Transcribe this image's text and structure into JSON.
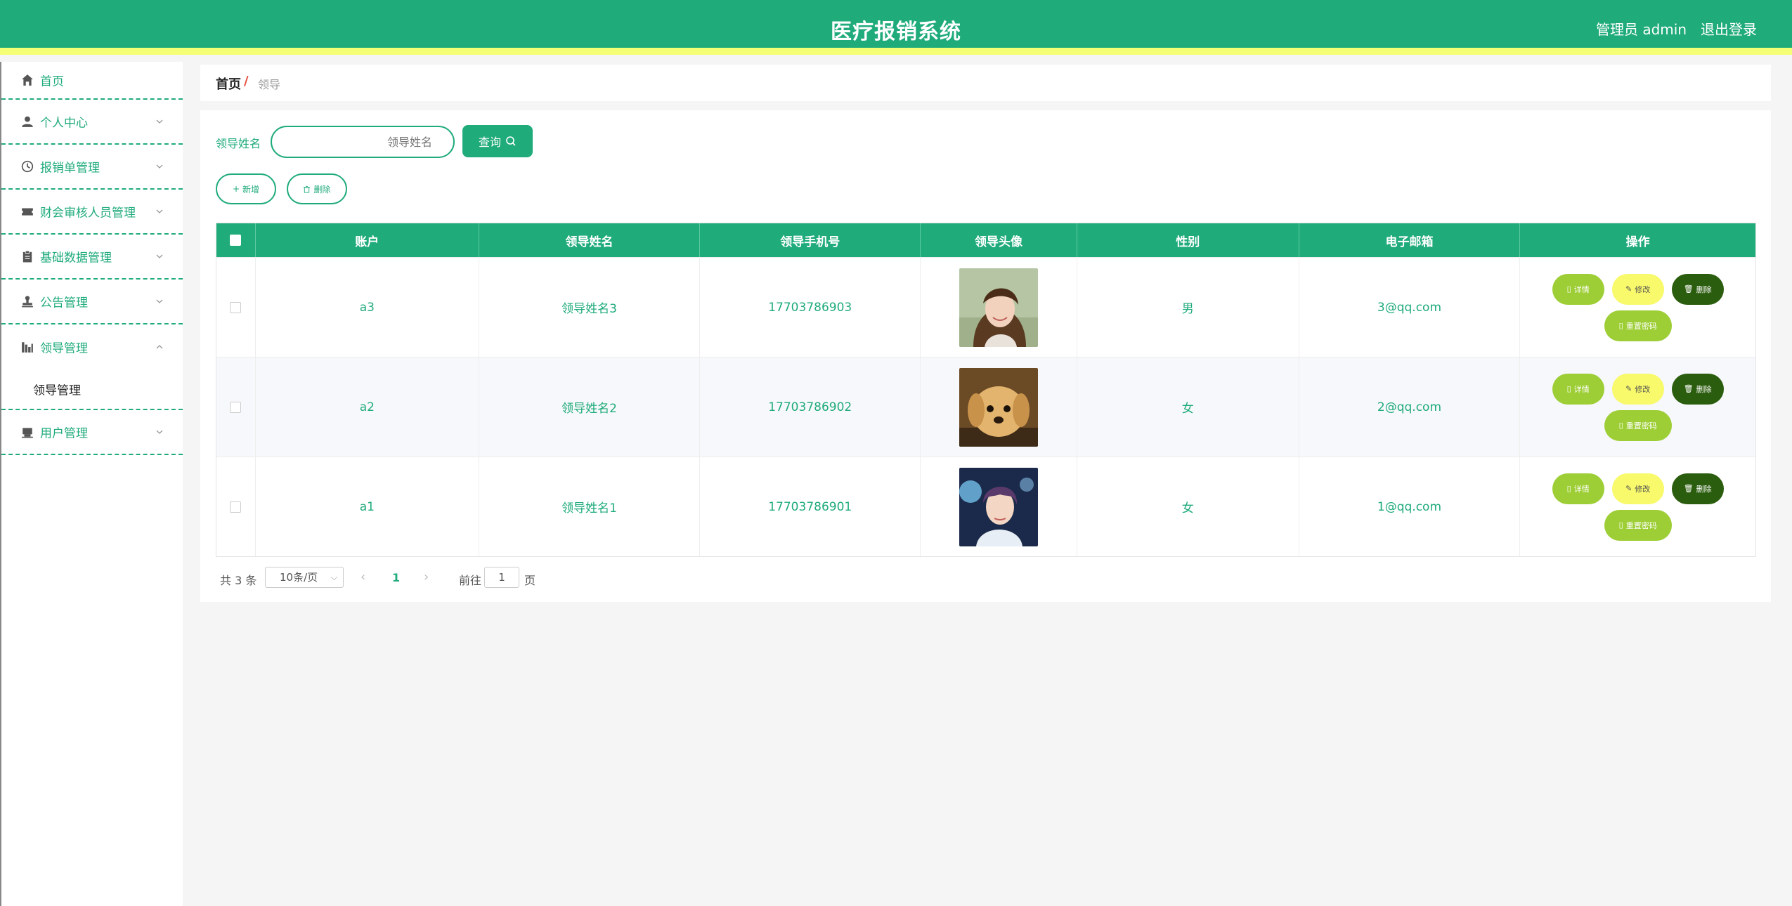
{
  "header": {
    "title": "医疗报销系统",
    "user": "管理员 admin",
    "logout": "退出登录"
  },
  "sidebar": {
    "items": [
      {
        "label": "首页",
        "icon": "home-icon"
      },
      {
        "label": "个人中心",
        "icon": "user-icon"
      },
      {
        "label": "报销单管理",
        "icon": "clock-icon"
      },
      {
        "label": "财会审核人员管理",
        "icon": "ticket-icon"
      },
      {
        "label": "基础数据管理",
        "icon": "clipboard-icon"
      },
      {
        "label": "公告管理",
        "icon": "stamp-icon"
      },
      {
        "label": "领导管理",
        "icon": "chart-icon"
      },
      {
        "label": "用户管理",
        "icon": "printer-icon"
      }
    ],
    "submenu_label": "领导管理"
  },
  "breadcrumb": {
    "home": "首页",
    "separator": "/",
    "current": "领导"
  },
  "search": {
    "label": "领导姓名",
    "placeholder": "领导姓名",
    "button": "查询"
  },
  "actions": {
    "add": "新增",
    "delete": "删除"
  },
  "table": {
    "headers": [
      "账户",
      "领导姓名",
      "领导手机号",
      "领导头像",
      "性别",
      "电子邮箱",
      "操作"
    ],
    "rows": [
      {
        "account": "a3",
        "name": "领导姓名3",
        "phone": "17703786903",
        "avatar": "woman-portrait",
        "gender": "男",
        "email": "3@qq.com"
      },
      {
        "account": "a2",
        "name": "领导姓名2",
        "phone": "17703786902",
        "avatar": "puppy",
        "gender": "女",
        "email": "2@qq.com"
      },
      {
        "account": "a1",
        "name": "领导姓名1",
        "phone": "17703786901",
        "avatar": "man-portrait",
        "gender": "女",
        "email": "1@qq.com"
      }
    ],
    "ops": {
      "detail": "详情",
      "edit": "修改",
      "delete": "删除",
      "reset": "重置密码"
    }
  },
  "pagination": {
    "total": "共 3 条",
    "page_size": "10条/页",
    "current_page": "1",
    "goto_label": "前往",
    "goto_value": "1",
    "page_unit": "页"
  },
  "colors": {
    "primary": "#1fab7a",
    "accent_bar": "#f4ff76",
    "detail": "#9dce35",
    "edit": "#f8f96b",
    "delete": "#2b5d0e"
  }
}
